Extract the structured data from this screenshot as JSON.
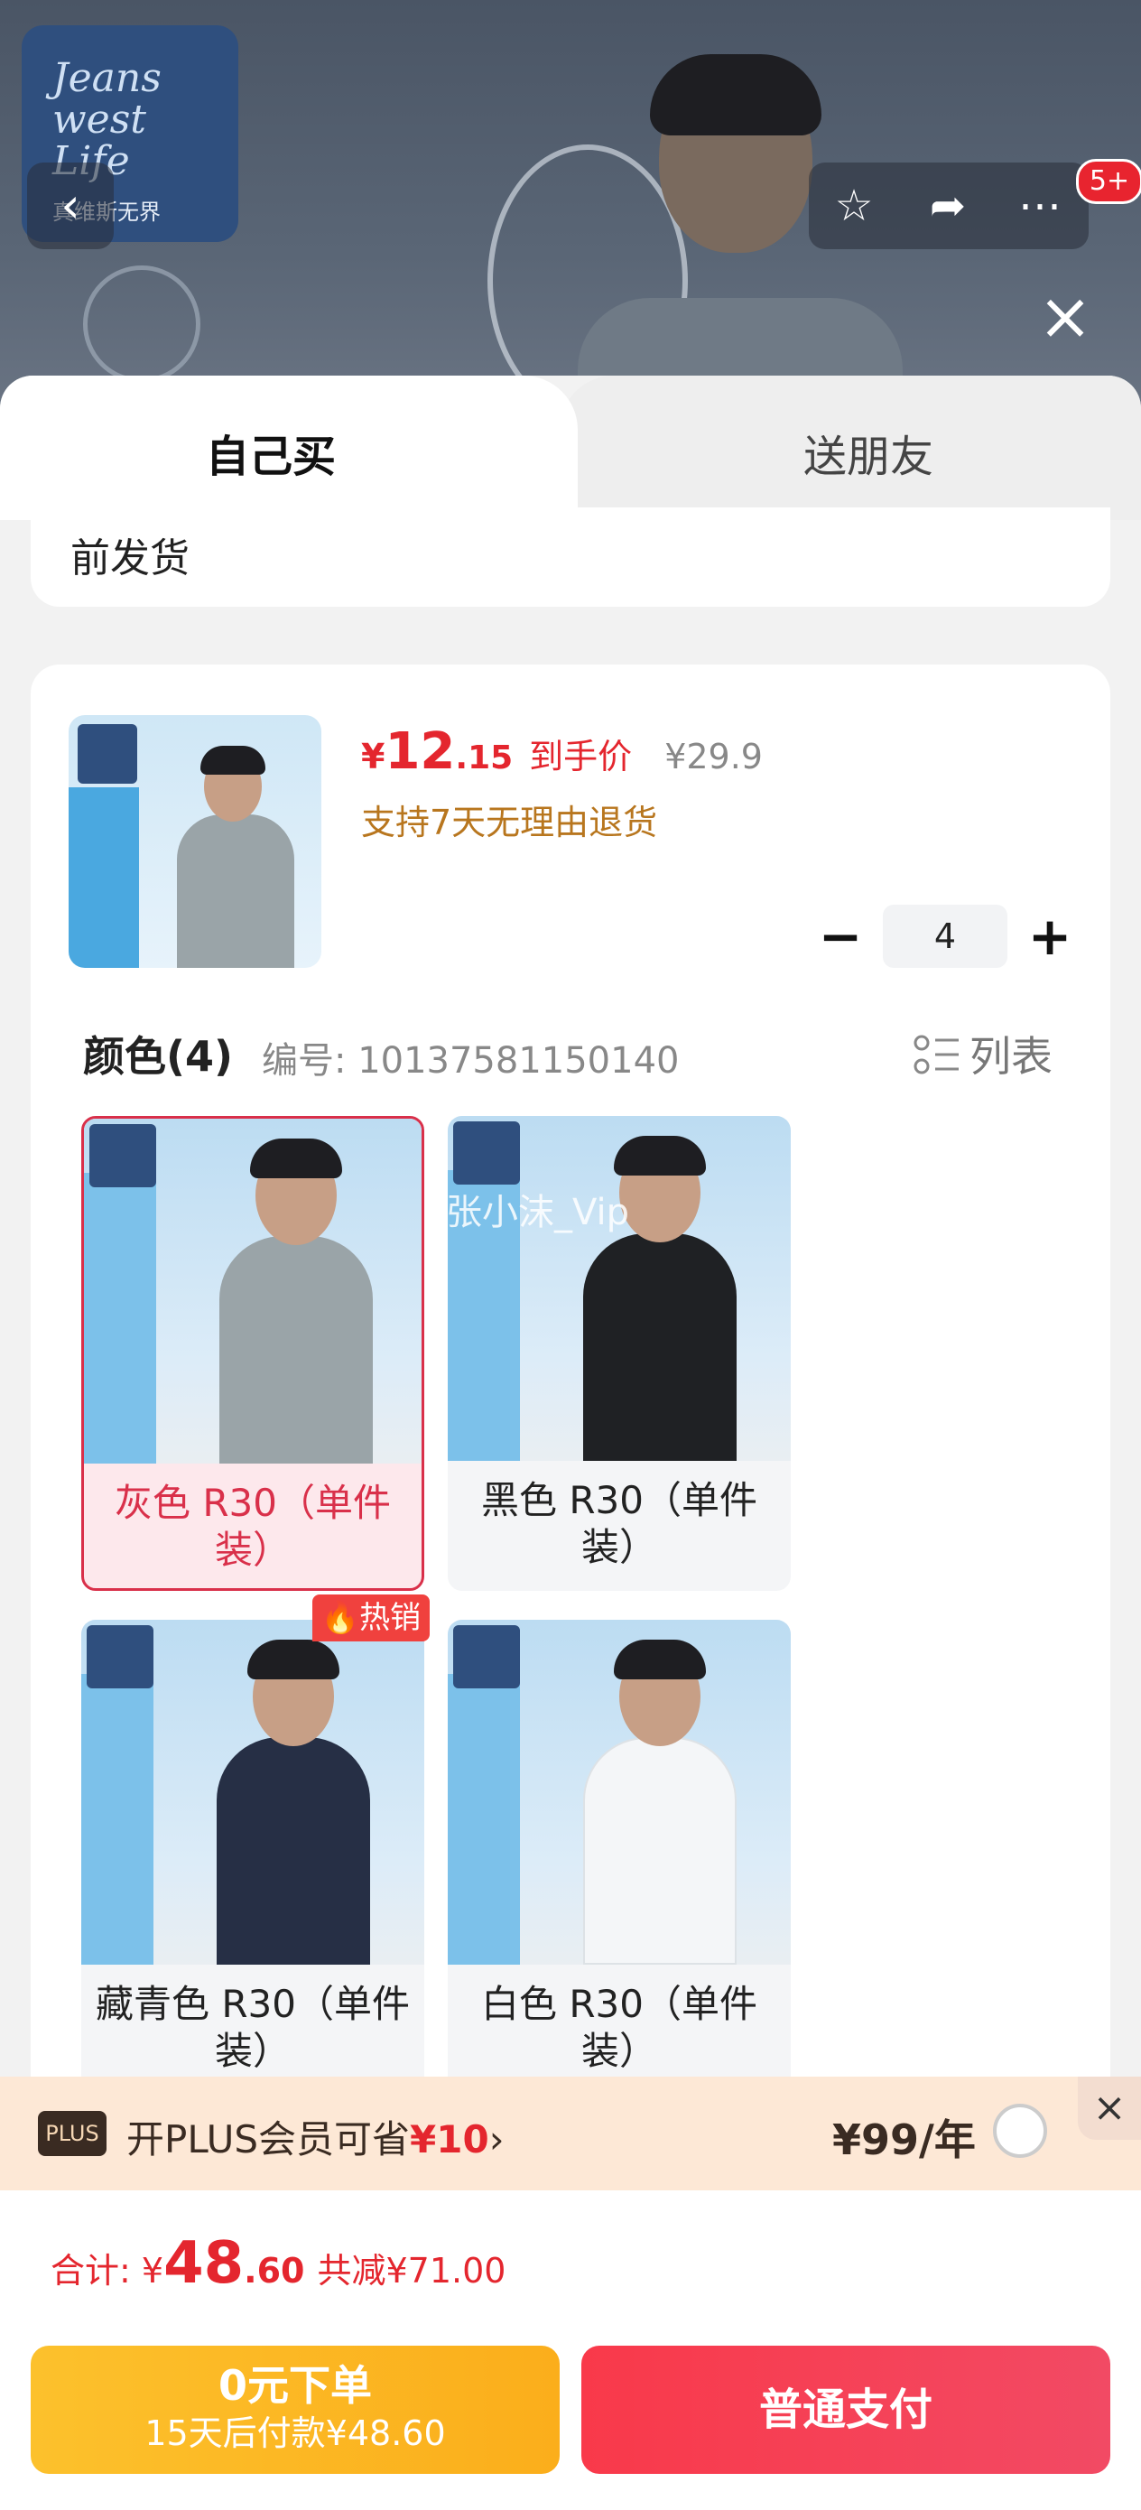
{
  "hero": {
    "brand_line1": "Jeans",
    "brand_line2": "west",
    "brand_line3": "Life",
    "brand_sub": "真维斯无界",
    "notif_badge": "5+"
  },
  "tabs": {
    "self": "自己买",
    "gift": "送朋友"
  },
  "delivery_snippet": "前发货",
  "product": {
    "price_currency": "¥",
    "price_int": "12",
    "price_dec": ".15",
    "price_tag": "到手价",
    "price_original": "¥29.9",
    "return_policy": "支持7天无理由退货",
    "quantity": "4"
  },
  "options": {
    "header": "颜色(4)",
    "code": "编号: 10137581150140",
    "list_toggle": "列表",
    "hot_badge": "热销",
    "watermark": "张小沫_Vip",
    "items": [
      {
        "label": "灰色 R30（单件装）",
        "color": "#9aa4a8",
        "selected": true
      },
      {
        "label": "黑色 R30（单件装）",
        "color": "#1f2124",
        "selected": false
      },
      {
        "label": "藏青色 R30（单件装）",
        "color": "#262f45",
        "selected": false
      },
      {
        "label": "白色 R30（单件装）",
        "color": "#f4f6f8",
        "selected": false
      }
    ]
  },
  "plus": {
    "badge": "PLUS",
    "text_prefix": "开PLUS会员可省",
    "text_amount": "¥10",
    "chevron": "›",
    "price": "¥99/年"
  },
  "total": {
    "label": "合计: ",
    "currency": "¥",
    "amount_int": "48",
    "amount_dec": ".60",
    "discount": "共减¥71.00"
  },
  "footer": {
    "later_title": "0元下单",
    "later_sub": "15天后付款¥48.60",
    "pay_label": "普通支付"
  },
  "colors": {
    "accent": "#e4262e",
    "pay": "#f9394a",
    "later": "#fcc12c"
  }
}
